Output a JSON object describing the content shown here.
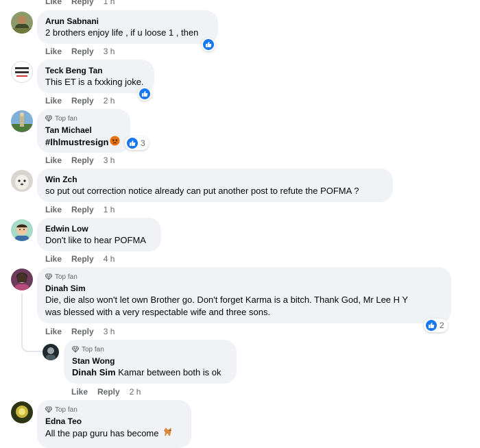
{
  "labels": {
    "like": "Like",
    "reply": "Reply"
  },
  "top_fan_label": "Top fan",
  "top_actions": {
    "time": "1 h"
  },
  "comments": [
    {
      "name": "Arun Sabnani",
      "text": "2 brothers enjoy life , if u loose 1 , then",
      "time": "3 h",
      "reaction": ""
    },
    {
      "name": "Teck Beng Tan",
      "text": "This ET is a fxxking joke.",
      "time": "2 h",
      "reaction": ""
    },
    {
      "name": "Tan Michael",
      "text": "#lhlmustresign",
      "time": "3 h",
      "reaction": "3"
    },
    {
      "name": "Win Zch",
      "text": "so put out correction notice already can put another post to refute the POFMA ?",
      "time": "1 h"
    },
    {
      "name": "Edwin Low",
      "text": "Don't like to hear POFMA",
      "time": "4 h"
    },
    {
      "name": "Dinah Sim",
      "text_line1": "Die, die also won't let own Brother go. Don't forget Karma is a bitch. Thank God, Mr Lee H Y",
      "text_line2": "was blessed with a very respectable wife and three sons.",
      "time": "3 h",
      "reaction": "2"
    },
    {
      "name": "Stan Wong",
      "mention": "Dinah Sim",
      "text": "Kamar between both is ok",
      "time": "2 h"
    },
    {
      "name": "Edna Teo",
      "text": "All the pap guru has become"
    }
  ],
  "colors": {
    "bubble": "#f0f2f5",
    "meta": "#65676b",
    "like_blue": "#1877f2",
    "angry": "#e9710f"
  },
  "icons": {
    "like": "thumbs-up-icon",
    "angry": "angry-face-icon",
    "top_fan": "diamond-icon",
    "dog": "dog-emoji"
  }
}
